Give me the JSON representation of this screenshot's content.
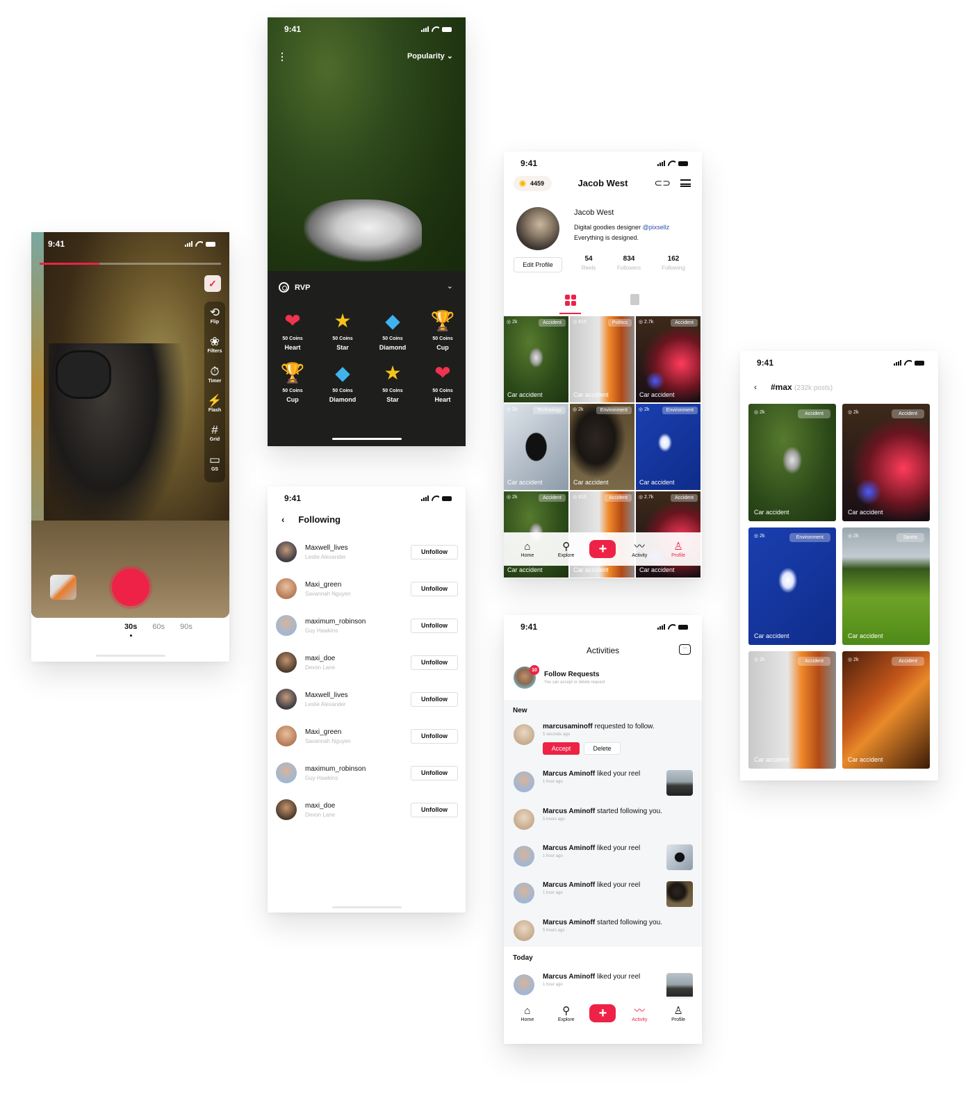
{
  "status_time": "9:41",
  "camera": {
    "recording_progress": 0.33,
    "tools": [
      {
        "icon": "flip-camera-icon",
        "glyph": "⟲",
        "label": "Flip"
      },
      {
        "icon": "filters-icon",
        "glyph": "❀",
        "label": "Filters"
      },
      {
        "icon": "timer-icon",
        "glyph": "⏱",
        "label": "Timer"
      },
      {
        "icon": "flash-off-icon",
        "glyph": "⚡",
        "label": "Flash"
      },
      {
        "icon": "grid-icon",
        "glyph": "#",
        "label": "Grid"
      },
      {
        "icon": "gs-icon",
        "glyph": "▭",
        "label": "GS"
      }
    ],
    "durations": [
      "30s",
      "60s",
      "90s"
    ],
    "selected_duration": "30s",
    "confirm_glyph": "✓"
  },
  "gift": {
    "menu_glyph": "⋮",
    "sort_label": "Popularity ⌄",
    "sheet_title": "RVP",
    "chevron": "⌄",
    "items": [
      {
        "icon": "heart-plant-icon",
        "glyph": "❤",
        "color": "#f0334f",
        "coins": "50 Coins",
        "name": "Heart"
      },
      {
        "icon": "star-badge-icon",
        "glyph": "★",
        "color": "#f7c21a",
        "coins": "50 Coins",
        "name": "Star"
      },
      {
        "icon": "diamond-icon",
        "glyph": "◆",
        "color": "#3fb3ee",
        "coins": "50 Coins",
        "name": "Diamond"
      },
      {
        "icon": "trophy-cup-icon",
        "glyph": "🏆",
        "color": "#f4c023",
        "coins": "50 Coins",
        "name": "Cup"
      },
      {
        "icon": "trophy-cup-icon",
        "glyph": "🏆",
        "color": "#f4c023",
        "coins": "50 Coins",
        "name": "Cup"
      },
      {
        "icon": "diamond-icon",
        "glyph": "◆",
        "color": "#3fb3ee",
        "coins": "50 Coins",
        "name": "Diamond"
      },
      {
        "icon": "star-badge-icon",
        "glyph": "★",
        "color": "#f7c21a",
        "coins": "50 Coins",
        "name": "Star"
      },
      {
        "icon": "heart-plant-icon",
        "glyph": "❤",
        "color": "#f0334f",
        "coins": "50 Coins",
        "name": "Heart"
      }
    ]
  },
  "following": {
    "back": "‹",
    "title": "Following",
    "button_label": "Unfollow",
    "users": [
      {
        "username": "Maxwell_lives",
        "name": "Leslie Alexander"
      },
      {
        "username": "Maxi_green",
        "name": "Savannah Nguyen"
      },
      {
        "username": "maximum_robinson",
        "name": "Guy Hawkins"
      },
      {
        "username": "maxi_doe",
        "name": "Devon Lane"
      },
      {
        "username": "Maxwell_lives",
        "name": "Leslie Alexander"
      },
      {
        "username": "Maxi_green",
        "name": "Savannah Nguyen"
      },
      {
        "username": "maximum_robinson",
        "name": "Guy Hawkins"
      },
      {
        "username": "maxi_doe",
        "name": "Devon Lane"
      }
    ]
  },
  "profile": {
    "coins": "4459",
    "title": "Jacob West",
    "link_glyph": "⊂⊃",
    "name": "Jacob West",
    "bio_line1": "Digital goodies designer ",
    "mention": "@pixsellz",
    "bio_line2": "Everything is designed.",
    "edit_label": "Edit Profile",
    "stats": [
      {
        "value": "54",
        "label": "Reels"
      },
      {
        "value": "834",
        "label": "Followers"
      },
      {
        "value": "162",
        "label": "Following"
      }
    ],
    "posts": [
      {
        "views": "◎ 2k",
        "tag": "Accident",
        "caption": "Car accident",
        "img": "hill"
      },
      {
        "views": "◎ 915",
        "tag": "Politics",
        "caption": "Car accident",
        "img": "fire"
      },
      {
        "views": "◎ 2.7k",
        "tag": "Accident",
        "caption": "Car accident",
        "img": "police"
      },
      {
        "views": "◎ 2k",
        "tag": "Technology",
        "caption": "Car accident",
        "img": "phone"
      },
      {
        "views": "◎ 2k",
        "tag": "Environment",
        "caption": "Car accident",
        "img": "mask"
      },
      {
        "views": "◎ 2k",
        "tag": "Environment",
        "caption": "Car accident",
        "img": "boat"
      },
      {
        "views": "◎ 2k",
        "tag": "Accident",
        "caption": "Car accident",
        "img": "hill"
      },
      {
        "views": "◎ 915",
        "tag": "Accident",
        "caption": "Car accident",
        "img": "fire"
      },
      {
        "views": "◎ 2.7k",
        "tag": "Accident",
        "caption": "Car accident",
        "img": "police"
      }
    ]
  },
  "nav": {
    "items": [
      {
        "icon": "home-icon",
        "glyph": "⌂",
        "label": "Home"
      },
      {
        "icon": "search-icon",
        "glyph": "⚲",
        "label": "Explore"
      },
      {
        "icon": "plus-icon",
        "glyph": "+",
        "label": ""
      },
      {
        "icon": "activity-icon",
        "glyph": "〰",
        "label": "Activity"
      },
      {
        "icon": "profile-icon",
        "glyph": "♙",
        "label": "Profile"
      }
    ],
    "accent": "#ee2247"
  },
  "activities": {
    "title": "Activities",
    "chat_glyph": "···",
    "follow_requests_title": "Follow Requests",
    "follow_requests_sub": "You can accept or delete request",
    "request_count": "10",
    "new_label": "New",
    "today_label": "Today",
    "accept_label": "Accept",
    "delete_label": "Delete",
    "new_items": [
      {
        "user": "marcusaminoff",
        "action": " requested to follow.",
        "time": "5 seconds ago",
        "thumb": null,
        "request": true
      },
      {
        "user": "Marcus Aminoff",
        "action": " liked your reel",
        "time": "1 hour ago",
        "thumb": "plane"
      },
      {
        "user": "Marcus Aminoff",
        "action": " started following you.",
        "time": "5 hours ago",
        "thumb": null
      },
      {
        "user": "Marcus Aminoff",
        "action": " liked your reel",
        "time": "1 hour ago",
        "thumb": "phone"
      },
      {
        "user": "Marcus Aminoff",
        "action": " liked your reel",
        "time": "1 hour ago",
        "thumb": "mask"
      },
      {
        "user": "Marcus Aminoff",
        "action": " started following you.",
        "time": "5 hours ago",
        "thumb": null
      }
    ],
    "today_items": [
      {
        "user": "Marcus Aminoff",
        "action": " liked your reel",
        "time": "1 hour ago",
        "thumb": "plane"
      }
    ]
  },
  "hashtag": {
    "back": "‹",
    "tag": "#max",
    "count": "(232k posts)",
    "posts": [
      {
        "views": "◎ 2k",
        "tag": "Accident",
        "caption": "Car accident",
        "img": "hill"
      },
      {
        "views": "◎ 2k",
        "tag": "Accident",
        "caption": "Car accident",
        "img": "police"
      },
      {
        "views": "◎ 2k",
        "tag": "Environment",
        "caption": "Car accident",
        "img": "boat"
      },
      {
        "views": "◎ 2k",
        "tag": "Sports",
        "caption": "Car accident",
        "img": "golf"
      },
      {
        "views": "◎ 2k",
        "tag": "Accident",
        "caption": "Car accident",
        "img": "fire"
      },
      {
        "views": "◎ 2k",
        "tag": "Accident",
        "caption": "Car accident",
        "img": "forest"
      }
    ]
  }
}
